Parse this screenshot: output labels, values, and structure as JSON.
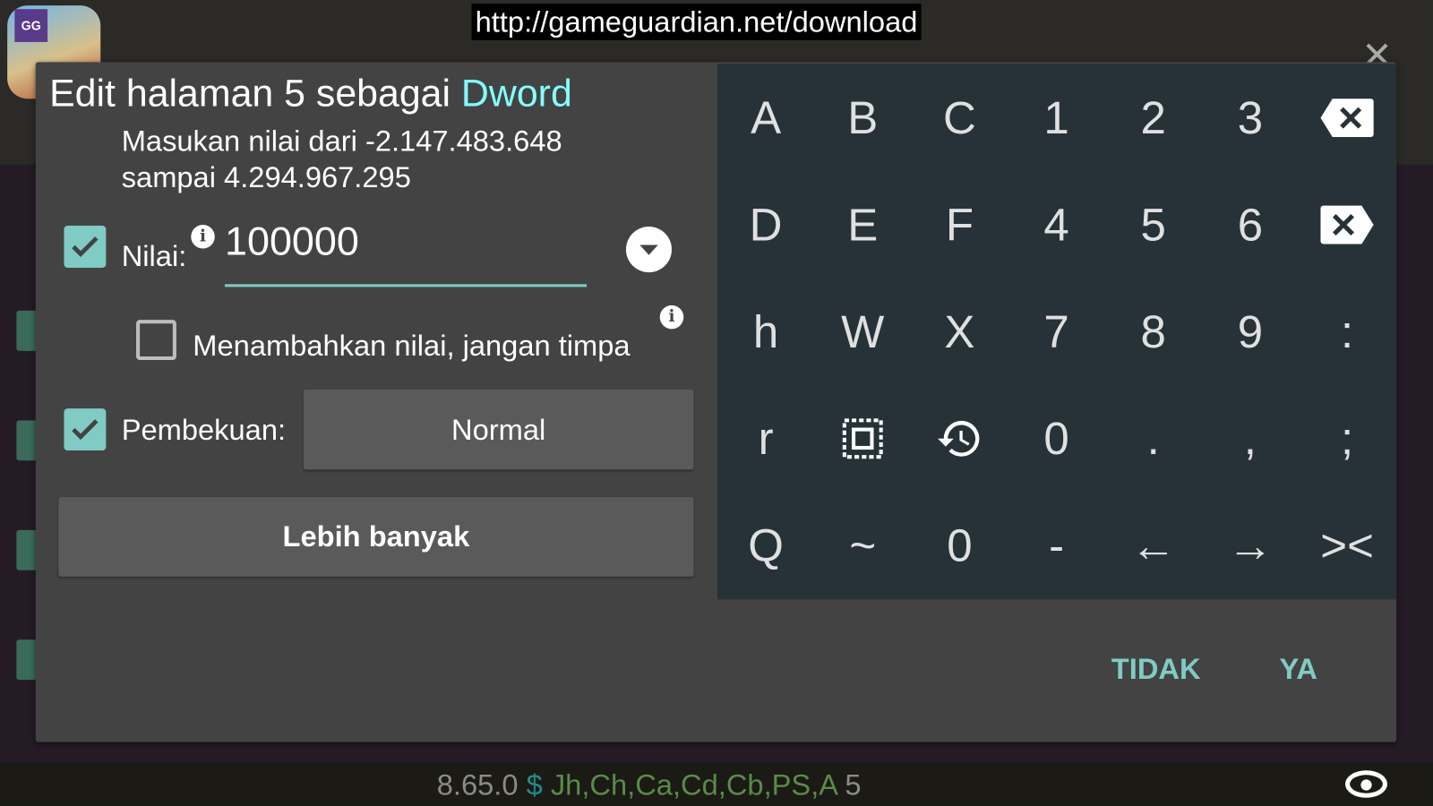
{
  "url_banner": "http://gameguardian.net/download",
  "app_icon_badge": "GG",
  "dialog": {
    "title_prefix": "Edit halaman 5 sebagai ",
    "title_type": "Dword",
    "hint_line1": "Masukan nilai dari -2.147.483.648",
    "hint_line2": "sampai 4.294.967.295",
    "value_label": "Nilai:",
    "value": "100000",
    "value_checked": true,
    "add_label": "Menambahkan nilai, jangan timpa",
    "add_checked": false,
    "freeze_label": "Pembekuan:",
    "freeze_checked": true,
    "freeze_mode": "Normal",
    "more_button": "Lebih banyak",
    "cancel_button": "TIDAK",
    "ok_button": "YA"
  },
  "keyboard": {
    "rows": [
      [
        "A",
        "B",
        "C",
        "1",
        "2",
        "3",
        "backspace-icon"
      ],
      [
        "D",
        "E",
        "F",
        "4",
        "5",
        "6",
        "delete-icon"
      ],
      [
        "h",
        "W",
        "X",
        "7",
        "8",
        "9",
        ":"
      ],
      [
        "r",
        "select-all-icon",
        "history-icon",
        "0",
        ".",
        ",",
        ";"
      ],
      [
        "Q",
        "~",
        "0",
        "-",
        "←",
        "→",
        "><"
      ]
    ]
  },
  "bottom_bar": {
    "version": "8.65.0",
    "dollar": "$",
    "flags": "Jh,Ch,Ca,Cd,Cb,PS,A",
    "count": "5"
  },
  "colors": {
    "accent": "#80cbc4",
    "title_accent": "#84ffff",
    "dialog_bg": "#434343",
    "keyboard_bg": "#263238"
  }
}
